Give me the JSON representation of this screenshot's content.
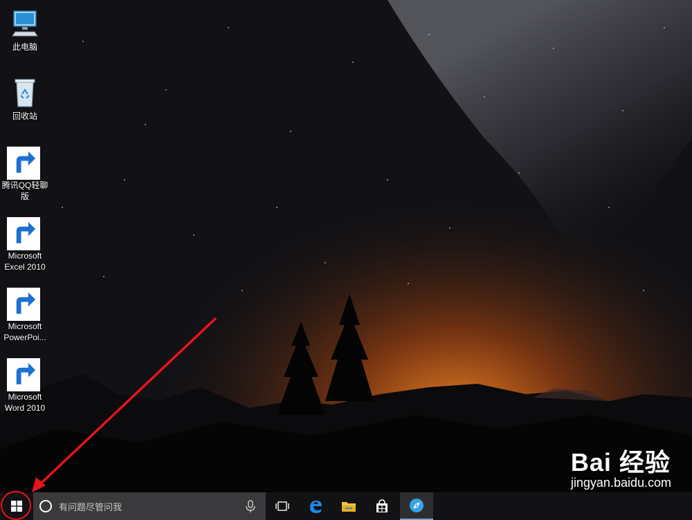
{
  "desktop": {
    "icons": [
      {
        "label": "此电脑",
        "icon": "computer-icon",
        "shortcut": false
      },
      {
        "label": "回收站",
        "icon": "recycle-bin-icon",
        "shortcut": false
      },
      {
        "label": "腾讯QQ轻聊版",
        "icon": "qq-penguin-icon",
        "shortcut": true
      },
      {
        "label": "Microsoft Excel 2010",
        "icon": "excel-icon",
        "shortcut": true
      },
      {
        "label": "Microsoft PowerPoi...",
        "icon": "powerpoint-icon",
        "shortcut": true
      },
      {
        "label": "Microsoft Word 2010",
        "icon": "word-icon",
        "shortcut": true
      }
    ]
  },
  "taskbar": {
    "search_placeholder": "有问题尽管问我",
    "pinned": [
      "task-view-icon",
      "edge-icon",
      "file-explorer-icon",
      "store-icon",
      "browser-icon"
    ]
  },
  "watermark": {
    "logo": "Bai 经验",
    "url": "jingyan.baidu.com"
  },
  "colors": {
    "taskbar": "#121214",
    "search_box": "#3a3a3c",
    "annotation_red": "#e8141a",
    "edge_blue": "#1e88e5"
  }
}
